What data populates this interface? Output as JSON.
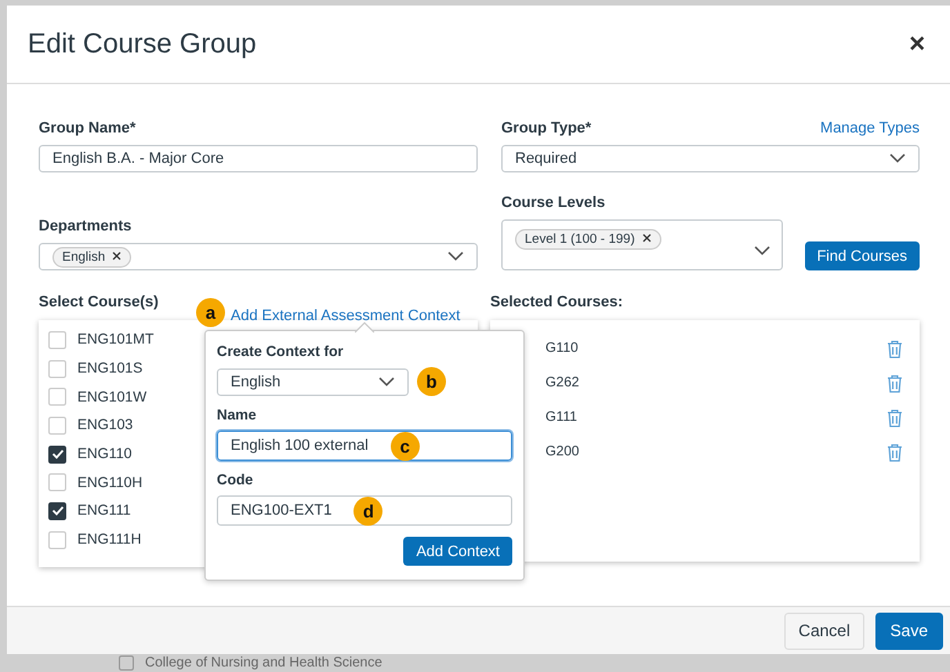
{
  "dialog": {
    "title": "Edit Course Group",
    "close": "×"
  },
  "group_name": {
    "label": "Group Name*",
    "value": "English B.A. - Major Core"
  },
  "group_type": {
    "label": "Group Type*",
    "value": "Required",
    "link": "Manage Types"
  },
  "departments": {
    "label": "Departments",
    "tags": [
      "English"
    ]
  },
  "course_levels": {
    "label": "Course Levels",
    "tags": [
      "Level 1 (100 - 199)"
    ]
  },
  "find_button": "Find Courses",
  "select_courses": {
    "label": "Select Course(s)",
    "link": "Add External Assessment Context",
    "items": [
      {
        "code": "ENG101MT",
        "checked": false
      },
      {
        "code": "ENG101S",
        "checked": false
      },
      {
        "code": "ENG101W",
        "checked": false
      },
      {
        "code": "ENG103",
        "checked": false
      },
      {
        "code": "ENG110",
        "checked": true
      },
      {
        "code": "ENG110H",
        "checked": false
      },
      {
        "code": "ENG111",
        "checked": true
      },
      {
        "code": "ENG111H",
        "checked": false
      }
    ]
  },
  "selected_courses": {
    "label": "Selected Courses:",
    "items": [
      "G110",
      "G262",
      "G111",
      "G200"
    ]
  },
  "popover": {
    "context_label": "Create Context for",
    "context_value": "English",
    "name_label": "Name",
    "name_value": "English 100 external",
    "code_label": "Code",
    "code_value": "ENG100-EXT1",
    "button": "Add Context"
  },
  "callouts": [
    "a",
    "b",
    "c",
    "d"
  ],
  "footer": {
    "cancel": "Cancel",
    "save": "Save"
  },
  "background_item": {
    "label": "College of Nursing and Health Science",
    "checked": false
  }
}
